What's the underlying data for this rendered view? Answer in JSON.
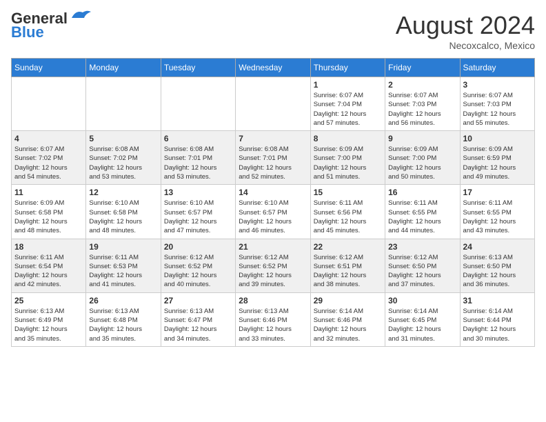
{
  "header": {
    "logo_line1": "General",
    "logo_line2": "Blue",
    "month_year": "August 2024",
    "location": "Necoxcalco, Mexico"
  },
  "calendar": {
    "days_of_week": [
      "Sunday",
      "Monday",
      "Tuesday",
      "Wednesday",
      "Thursday",
      "Friday",
      "Saturday"
    ],
    "weeks": [
      [
        {
          "day": "",
          "info": ""
        },
        {
          "day": "",
          "info": ""
        },
        {
          "day": "",
          "info": ""
        },
        {
          "day": "",
          "info": ""
        },
        {
          "day": "1",
          "info": "Sunrise: 6:07 AM\nSunset: 7:04 PM\nDaylight: 12 hours\nand 57 minutes."
        },
        {
          "day": "2",
          "info": "Sunrise: 6:07 AM\nSunset: 7:03 PM\nDaylight: 12 hours\nand 56 minutes."
        },
        {
          "day": "3",
          "info": "Sunrise: 6:07 AM\nSunset: 7:03 PM\nDaylight: 12 hours\nand 55 minutes."
        }
      ],
      [
        {
          "day": "4",
          "info": "Sunrise: 6:07 AM\nSunset: 7:02 PM\nDaylight: 12 hours\nand 54 minutes."
        },
        {
          "day": "5",
          "info": "Sunrise: 6:08 AM\nSunset: 7:02 PM\nDaylight: 12 hours\nand 53 minutes."
        },
        {
          "day": "6",
          "info": "Sunrise: 6:08 AM\nSunset: 7:01 PM\nDaylight: 12 hours\nand 53 minutes."
        },
        {
          "day": "7",
          "info": "Sunrise: 6:08 AM\nSunset: 7:01 PM\nDaylight: 12 hours\nand 52 minutes."
        },
        {
          "day": "8",
          "info": "Sunrise: 6:09 AM\nSunset: 7:00 PM\nDaylight: 12 hours\nand 51 minutes."
        },
        {
          "day": "9",
          "info": "Sunrise: 6:09 AM\nSunset: 7:00 PM\nDaylight: 12 hours\nand 50 minutes."
        },
        {
          "day": "10",
          "info": "Sunrise: 6:09 AM\nSunset: 6:59 PM\nDaylight: 12 hours\nand 49 minutes."
        }
      ],
      [
        {
          "day": "11",
          "info": "Sunrise: 6:09 AM\nSunset: 6:58 PM\nDaylight: 12 hours\nand 48 minutes."
        },
        {
          "day": "12",
          "info": "Sunrise: 6:10 AM\nSunset: 6:58 PM\nDaylight: 12 hours\nand 48 minutes."
        },
        {
          "day": "13",
          "info": "Sunrise: 6:10 AM\nSunset: 6:57 PM\nDaylight: 12 hours\nand 47 minutes."
        },
        {
          "day": "14",
          "info": "Sunrise: 6:10 AM\nSunset: 6:57 PM\nDaylight: 12 hours\nand 46 minutes."
        },
        {
          "day": "15",
          "info": "Sunrise: 6:11 AM\nSunset: 6:56 PM\nDaylight: 12 hours\nand 45 minutes."
        },
        {
          "day": "16",
          "info": "Sunrise: 6:11 AM\nSunset: 6:55 PM\nDaylight: 12 hours\nand 44 minutes."
        },
        {
          "day": "17",
          "info": "Sunrise: 6:11 AM\nSunset: 6:55 PM\nDaylight: 12 hours\nand 43 minutes."
        }
      ],
      [
        {
          "day": "18",
          "info": "Sunrise: 6:11 AM\nSunset: 6:54 PM\nDaylight: 12 hours\nand 42 minutes."
        },
        {
          "day": "19",
          "info": "Sunrise: 6:11 AM\nSunset: 6:53 PM\nDaylight: 12 hours\nand 41 minutes."
        },
        {
          "day": "20",
          "info": "Sunrise: 6:12 AM\nSunset: 6:52 PM\nDaylight: 12 hours\nand 40 minutes."
        },
        {
          "day": "21",
          "info": "Sunrise: 6:12 AM\nSunset: 6:52 PM\nDaylight: 12 hours\nand 39 minutes."
        },
        {
          "day": "22",
          "info": "Sunrise: 6:12 AM\nSunset: 6:51 PM\nDaylight: 12 hours\nand 38 minutes."
        },
        {
          "day": "23",
          "info": "Sunrise: 6:12 AM\nSunset: 6:50 PM\nDaylight: 12 hours\nand 37 minutes."
        },
        {
          "day": "24",
          "info": "Sunrise: 6:13 AM\nSunset: 6:50 PM\nDaylight: 12 hours\nand 36 minutes."
        }
      ],
      [
        {
          "day": "25",
          "info": "Sunrise: 6:13 AM\nSunset: 6:49 PM\nDaylight: 12 hours\nand 35 minutes."
        },
        {
          "day": "26",
          "info": "Sunrise: 6:13 AM\nSunset: 6:48 PM\nDaylight: 12 hours\nand 35 minutes."
        },
        {
          "day": "27",
          "info": "Sunrise: 6:13 AM\nSunset: 6:47 PM\nDaylight: 12 hours\nand 34 minutes."
        },
        {
          "day": "28",
          "info": "Sunrise: 6:13 AM\nSunset: 6:46 PM\nDaylight: 12 hours\nand 33 minutes."
        },
        {
          "day": "29",
          "info": "Sunrise: 6:14 AM\nSunset: 6:46 PM\nDaylight: 12 hours\nand 32 minutes."
        },
        {
          "day": "30",
          "info": "Sunrise: 6:14 AM\nSunset: 6:45 PM\nDaylight: 12 hours\nand 31 minutes."
        },
        {
          "day": "31",
          "info": "Sunrise: 6:14 AM\nSunset: 6:44 PM\nDaylight: 12 hours\nand 30 minutes."
        }
      ]
    ]
  }
}
